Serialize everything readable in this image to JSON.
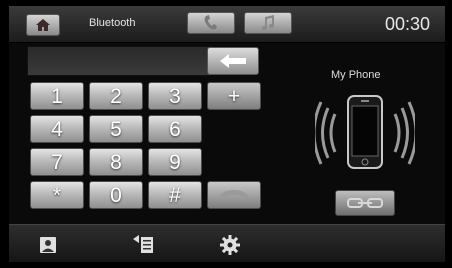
{
  "header": {
    "title": "Bluetooth",
    "clock": "00:30",
    "tabs": [
      {
        "name": "phone",
        "icon": "phone-handset-icon"
      },
      {
        "name": "music",
        "icon": "music-note-icon"
      }
    ]
  },
  "dialer": {
    "number": "",
    "keys": [
      "1",
      "2",
      "3",
      "+",
      "4",
      "5",
      "6",
      "7",
      "8",
      "9",
      "*",
      "0",
      "#"
    ]
  },
  "device": {
    "name": "My Phone"
  },
  "bottom_nav": [
    {
      "icon": "contacts-icon"
    },
    {
      "icon": "call-log-icon"
    },
    {
      "icon": "settings-gear-icon"
    }
  ],
  "colors": {
    "button_top": "#e4e4e4",
    "button_bottom": "#8f8f8f",
    "background": "#0a0a0a"
  }
}
